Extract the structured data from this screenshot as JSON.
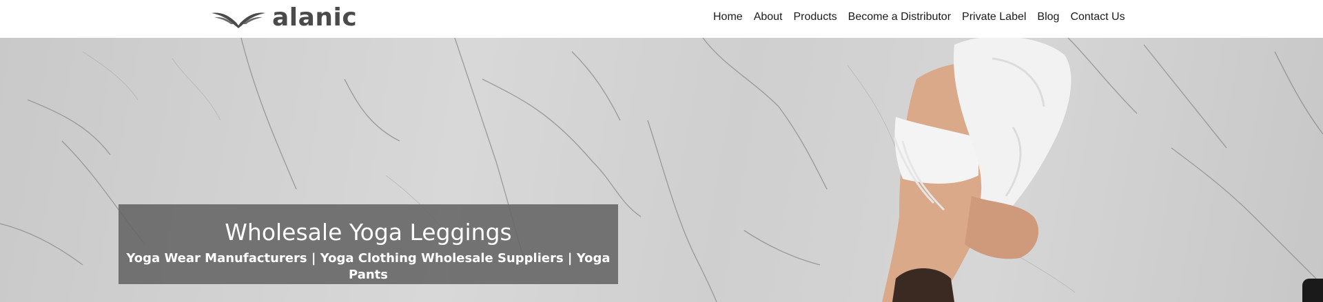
{
  "header": {
    "logo_text": "alanic",
    "logo_icon": "wings-logo-icon"
  },
  "nav": {
    "items": [
      {
        "label": "Home"
      },
      {
        "label": "About"
      },
      {
        "label": "Products"
      },
      {
        "label": "Become a Distributor"
      },
      {
        "label": "Private Label"
      },
      {
        "label": "Blog"
      },
      {
        "label": "Contact Us"
      }
    ]
  },
  "hero": {
    "title": "Wholesale Yoga Leggings",
    "subtitle": "Yoga Wear Manufacturers | Yoga Clothing Wholesale Suppliers | Yoga Pants"
  },
  "side_tab": {
    "icon": "side-tab-icon"
  },
  "colors": {
    "caption_bg": "#646464",
    "text_dark": "#1a1a1a",
    "logo_gray": "#4a4a4a"
  }
}
